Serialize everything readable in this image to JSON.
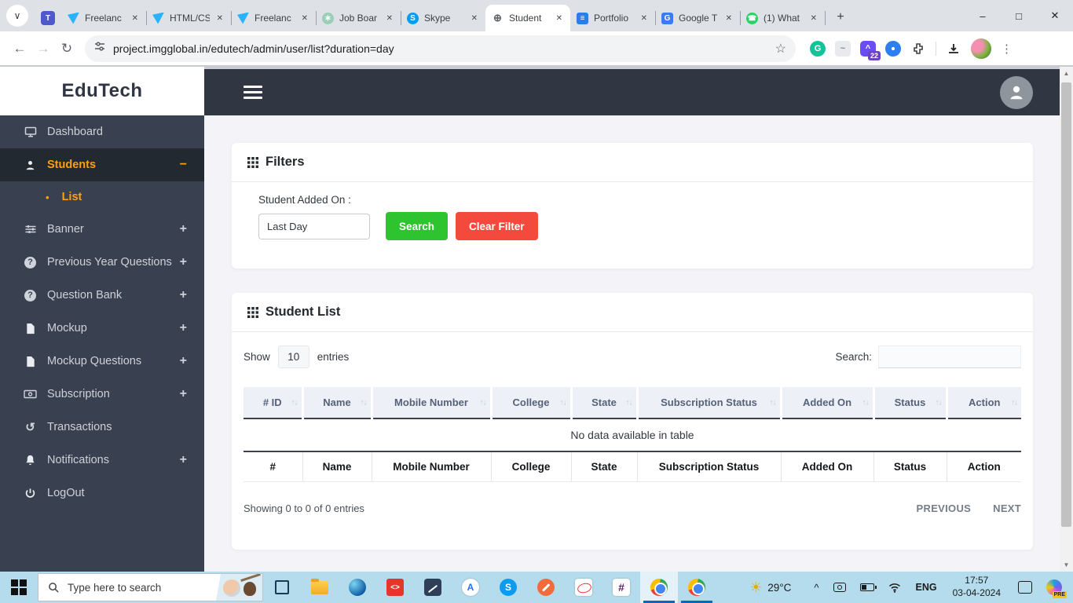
{
  "glyphs": {
    "tab_dropdown": "∨",
    "close": "✕",
    "new_tab": "+",
    "minimize": "–",
    "maximize": "□",
    "win_close": "✕",
    "back": "←",
    "forward": "→",
    "reload": "↻",
    "star": "☆",
    "menu_dots": "⋮",
    "sort_up": "↑",
    "sort_down": "↓",
    "bullet": "•",
    "question": "?",
    "history": "↺",
    "scroll_up": "▲",
    "scroll_down": "▼",
    "chevron_up": "^",
    "teams": "T",
    "freelancer": "",
    "chatgpt": "∗",
    "skype": "S",
    "globe": "⊕",
    "docs": "≡",
    "translate": "G",
    "whatsapp": "☎",
    "grammarly": "G",
    "wave": "~",
    "ext_arrow": "^"
  },
  "browser": {
    "tabs": [
      {
        "title": "Freelanc"
      },
      {
        "title": "HTML/CS"
      },
      {
        "title": "Freelanc"
      },
      {
        "title": "Job Boar"
      },
      {
        "title": "Skype"
      },
      {
        "title": "Student"
      },
      {
        "title": "Portfolio"
      },
      {
        "title": "Google T"
      },
      {
        "title": "(1) What"
      }
    ],
    "url": "project.imgglobal.in/edutech/admin/user/list?duration=day",
    "extension_badge": "22"
  },
  "sidebar": {
    "brand": "EduTech",
    "items": [
      {
        "label": "Dashboard",
        "expand": ""
      },
      {
        "label": "Students",
        "expand": "−"
      },
      {
        "label": "List"
      },
      {
        "label": "Banner",
        "expand": "+"
      },
      {
        "label": "Previous Year Questions",
        "expand": "+"
      },
      {
        "label": "Question Bank",
        "expand": "+"
      },
      {
        "label": "Mockup",
        "expand": "+"
      },
      {
        "label": "Mockup Questions",
        "expand": "+"
      },
      {
        "label": "Subscription",
        "expand": "+"
      },
      {
        "label": "Transactions",
        "expand": ""
      },
      {
        "label": "Notifications",
        "expand": "+"
      },
      {
        "label": "LogOut",
        "expand": ""
      }
    ]
  },
  "filters": {
    "title": "Filters",
    "label": "Student Added On :",
    "value": "Last Day",
    "search_btn": "Search",
    "clear_btn": "Clear Filter"
  },
  "student_list": {
    "title": "Student List",
    "show": "Show",
    "page_size": "10",
    "entries": "entries",
    "search_label": "Search:",
    "columns": [
      "# ID",
      "Name",
      "Mobile Number",
      "College",
      "State",
      "Subscription Status",
      "Added On",
      "Status",
      "Action"
    ],
    "footer_columns": [
      "#",
      "Name",
      "Mobile Number",
      "College",
      "State",
      "Subscription Status",
      "Added On",
      "Status",
      "Action"
    ],
    "empty_message": "No data available in table",
    "info": "Showing 0 to 0 of 0 entries",
    "prev": "PREVIOUS",
    "next": "NEXT"
  },
  "taskbar": {
    "search_placeholder": "Type here to search",
    "glyph_code": "<>",
    "glyph_a": "A",
    "glyph_s": "S",
    "glyph_hash": "#",
    "weather_glyph": "☀",
    "temp": "29°C",
    "lang": "ENG",
    "time": "17:57",
    "date": "03-04-2024",
    "copilot_badge": "PRE"
  },
  "theme": {
    "accent_orange": "#ff9f0f",
    "button_green": "#2dc42f",
    "button_red": "#f4493d",
    "sidebar_bg": "#394150",
    "topbar_bg": "#303642",
    "taskbar_bg": "#b5dcec",
    "table_head_bg": "#edf1f7"
  }
}
